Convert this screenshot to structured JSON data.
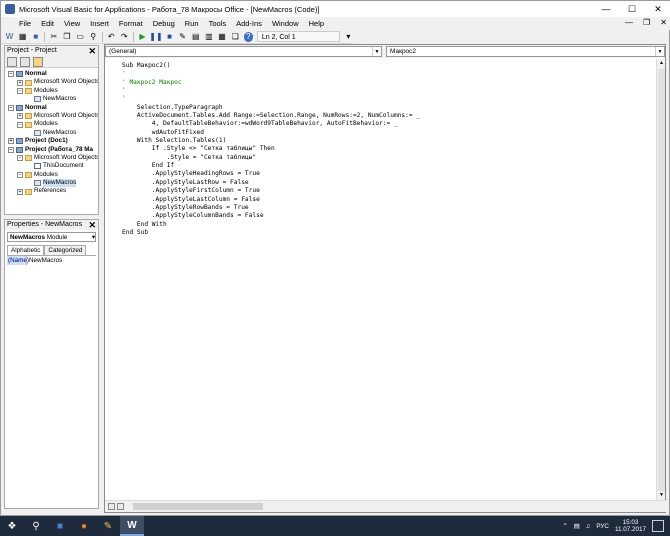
{
  "window": {
    "title": "Microsoft Visual Basic for Applications - Работа_78 Макросы Office - [NewMacros (Code)]"
  },
  "menu": [
    "File",
    "Edit",
    "View",
    "Insert",
    "Format",
    "Debug",
    "Run",
    "Tools",
    "Add-Ins",
    "Window",
    "Help"
  ],
  "toolbar": {
    "cursor_pos": "Ln 2, Col 1"
  },
  "project_pane": {
    "title": "Project - Project",
    "tree": [
      {
        "label": "Normal",
        "level": 0,
        "type": "proj",
        "bold": true,
        "exp": "−"
      },
      {
        "label": "Microsoft Word Objects",
        "level": 1,
        "type": "folder",
        "exp": "+"
      },
      {
        "label": "Modules",
        "level": 1,
        "type": "folder",
        "exp": "−"
      },
      {
        "label": "NewMacros",
        "level": 2,
        "type": "mod"
      },
      {
        "label": "Normal",
        "level": 0,
        "type": "proj",
        "bold": true,
        "exp": "−"
      },
      {
        "label": "Microsoft Word Objects",
        "level": 1,
        "type": "folder",
        "exp": "+"
      },
      {
        "label": "Modules",
        "level": 1,
        "type": "folder",
        "exp": "−"
      },
      {
        "label": "NewMacros",
        "level": 2,
        "type": "mod"
      },
      {
        "label": "Project (Doc1)",
        "level": 0,
        "type": "proj",
        "bold": true,
        "exp": "+"
      },
      {
        "label": "Project (Работа_78 Ма",
        "level": 0,
        "type": "proj",
        "bold": true,
        "exp": "−"
      },
      {
        "label": "Microsoft Word Objects",
        "level": 1,
        "type": "folder",
        "exp": "−"
      },
      {
        "label": "ThisDocument",
        "level": 2,
        "type": "doc"
      },
      {
        "label": "Modules",
        "level": 1,
        "type": "folder",
        "exp": "−"
      },
      {
        "label": "NewMacros",
        "level": 2,
        "type": "mod",
        "selected": true
      },
      {
        "label": "References",
        "level": 1,
        "type": "folder",
        "exp": "+"
      }
    ]
  },
  "properties_pane": {
    "title": "Properties - NewMacros",
    "object_name": "NewMacros",
    "object_type": "Module",
    "tabs": [
      "Alphabetic",
      "Categorized"
    ],
    "rows": [
      {
        "key": "(Name)",
        "value": "NewMacros"
      }
    ]
  },
  "code_window": {
    "object_combo": "(General)",
    "proc_combo": "Макрос2",
    "lines": [
      {
        "t": "Sub Макрос2()",
        "c": ""
      },
      {
        "t": "'",
        "c": "cm"
      },
      {
        "t": "' Макрос2 Макрос",
        "c": "cm"
      },
      {
        "t": "'",
        "c": "cm"
      },
      {
        "t": "'",
        "c": "cm"
      },
      {
        "t": "    Selection.TypeParagraph",
        "c": ""
      },
      {
        "t": "    ActiveDocument.Tables.Add Range:=Selection.Range, NumRows:=2, NumColumns:= _",
        "c": ""
      },
      {
        "t": "        4, DefaultTableBehavior:=wdWord9TableBehavior, AutoFitBehavior:= _",
        "c": ""
      },
      {
        "t": "        wdAutoFitFixed",
        "c": ""
      },
      {
        "t": "    With Selection.Tables(1)",
        "c": ""
      },
      {
        "t": "        If .Style <> \"Сетка таблицы\" Then",
        "c": ""
      },
      {
        "t": "            .Style = \"Сетка таблицы\"",
        "c": ""
      },
      {
        "t": "        End If",
        "c": ""
      },
      {
        "t": "        .ApplyStyleHeadingRows = True",
        "c": ""
      },
      {
        "t": "        .ApplyStyleLastRow = False",
        "c": ""
      },
      {
        "t": "        .ApplyStyleFirstColumn = True",
        "c": ""
      },
      {
        "t": "        .ApplyStyleLastColumn = False",
        "c": ""
      },
      {
        "t": "        .ApplyStyleRowBands = True",
        "c": ""
      },
      {
        "t": "        .ApplyStyleColumnBands = False",
        "c": ""
      },
      {
        "t": "    End With",
        "c": ""
      },
      {
        "t": "End Sub",
        "c": ""
      }
    ]
  },
  "taskbar": {
    "lang": "РУС",
    "time": "15:03",
    "date": "11.07.2017"
  }
}
